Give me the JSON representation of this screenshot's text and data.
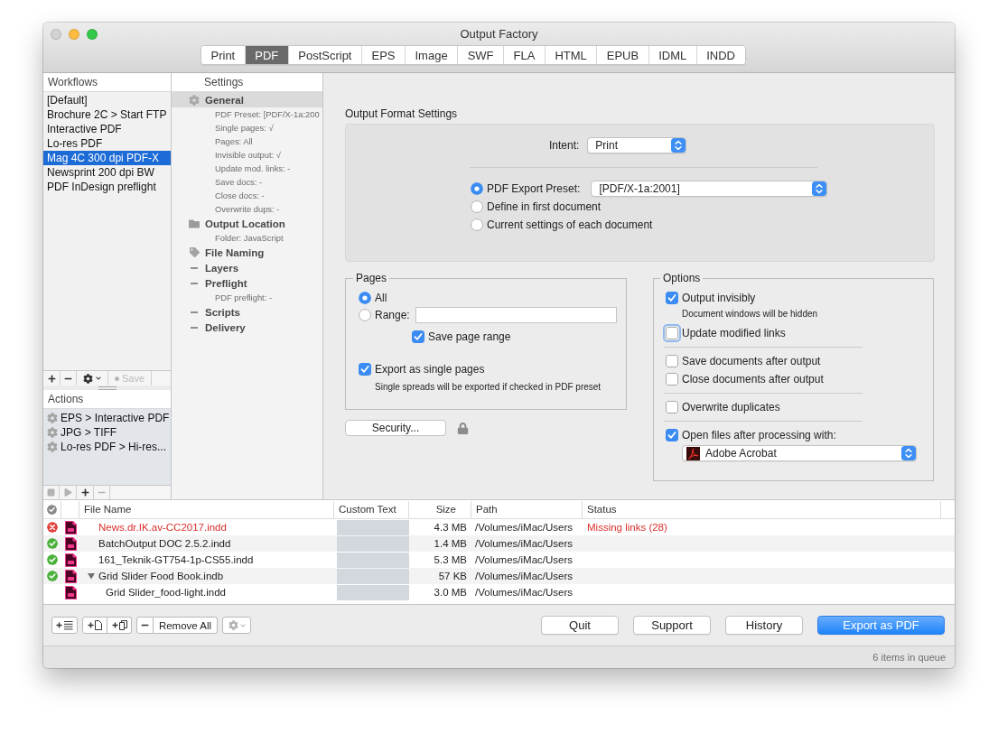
{
  "window": {
    "title": "Output Factory"
  },
  "format_tabs": [
    {
      "label": "Print",
      "selected": false
    },
    {
      "label": "PDF",
      "selected": true
    },
    {
      "label": "PostScript",
      "selected": false
    },
    {
      "label": "EPS",
      "selected": false
    },
    {
      "label": "Image",
      "selected": false
    },
    {
      "label": "SWF",
      "selected": false
    },
    {
      "label": "FLA",
      "selected": false
    },
    {
      "label": "HTML",
      "selected": false
    },
    {
      "label": "EPUB",
      "selected": false
    },
    {
      "label": "IDML",
      "selected": false
    },
    {
      "label": "INDD",
      "selected": false
    }
  ],
  "workflows": {
    "header": "Workflows",
    "items": [
      {
        "label": "[Default]",
        "selected": false
      },
      {
        "label": "Brochure 2C > Start FTP",
        "selected": false
      },
      {
        "label": "Interactive PDF",
        "selected": false
      },
      {
        "label": "Lo-res PDF",
        "selected": false
      },
      {
        "label": "Mag 4C 300 dpi PDF-X",
        "selected": true
      },
      {
        "label": "Newsprint 200 dpi BW",
        "selected": false
      },
      {
        "label": "PDF InDesign preflight",
        "selected": false
      }
    ],
    "tools": [
      {
        "kind": "add",
        "disabled": false
      },
      {
        "kind": "remove",
        "disabled": false
      },
      {
        "kind": "gear_menu",
        "disabled": false
      },
      {
        "kind": "save",
        "label": "Save",
        "disabled": true
      }
    ]
  },
  "actions": {
    "header": "Actions",
    "items": [
      {
        "label": "EPS > Interactive PDF"
      },
      {
        "label": "JPG > TIFF"
      },
      {
        "label": "Lo-res PDF > Hi-res..."
      }
    ],
    "tools": [
      {
        "kind": "stop",
        "disabled": true
      },
      {
        "kind": "play",
        "disabled": true
      },
      {
        "kind": "add",
        "disabled": false
      },
      {
        "kind": "remove",
        "disabled": true
      }
    ]
  },
  "settings": {
    "header": "Settings",
    "sections": [
      {
        "title": "General",
        "kind": "gear",
        "selected": true,
        "details": [
          "PDF Preset: [PDF/X-1a:200",
          "Single pages: √",
          "Pages: All",
          "Invisible output: √",
          "Update mod. links: -",
          "Save docs: -",
          "Close docs: -",
          "Overwrite dups: -"
        ]
      },
      {
        "title": "Output Location",
        "kind": "folder",
        "selected": false,
        "details": [
          "Folder: JavaScript"
        ]
      },
      {
        "title": "File Naming",
        "kind": "tag",
        "selected": false
      },
      {
        "title": "Layers",
        "kind": "dash",
        "selected": false
      },
      {
        "title": "Preflight",
        "kind": "dash",
        "selected": false,
        "details": [
          "PDF preflight: -"
        ]
      },
      {
        "title": "Scripts",
        "kind": "dash",
        "selected": false
      },
      {
        "title": "Delivery",
        "kind": "dash",
        "selected": false
      }
    ]
  },
  "output_format": {
    "title": "Output Format Settings",
    "intent": {
      "label": "Intent:",
      "value": "Print"
    },
    "preset_options": [
      {
        "label": "PDF Export Preset:",
        "selected": true,
        "value": "[PDF/X-1a:2001]"
      },
      {
        "label": "Define in first document",
        "selected": false
      },
      {
        "label": "Current settings of each document",
        "selected": false
      }
    ]
  },
  "pages": {
    "title": "Pages",
    "options": [
      {
        "label": "All",
        "selected": true
      },
      {
        "label": "Range:",
        "selected": false,
        "kind": "field"
      }
    ],
    "save_page_range": {
      "label": "Save page range",
      "checked": true
    },
    "single_pages": {
      "label": "Export as single pages",
      "checked": true,
      "note": "Single spreads will be exported if checked in PDF preset"
    }
  },
  "security_button": {
    "label": "Security..."
  },
  "options": {
    "title": "Options",
    "groups": [
      {
        "items": [
          {
            "label": "Output invisibly",
            "checked": true,
            "focused": false,
            "note": "Document windows will be hidden"
          },
          {
            "label": "Update modified links",
            "checked": false,
            "focused": true
          }
        ]
      },
      {
        "items": [
          {
            "label": "Save documents after output",
            "checked": false,
            "focused": false
          },
          {
            "label": "Close documents after output",
            "checked": false,
            "focused": false
          }
        ]
      },
      {
        "items": [
          {
            "label": "Overwrite duplicates",
            "checked": false,
            "focused": false
          }
        ]
      },
      {
        "items": [
          {
            "label": "Open files after processing with:",
            "checked": true,
            "focused": false,
            "app": "Adobe Acrobat"
          }
        ]
      }
    ]
  },
  "files": {
    "columns": [
      "File Name",
      "Custom Text",
      "Size",
      "Path",
      "Status"
    ],
    "rows": [
      {
        "kind": "error",
        "name": "News.dr.IK.av-CC2017.indd",
        "size": "4.3 MB",
        "path": "/Volumes/iMac/Users",
        "status": "Missing links (28)"
      },
      {
        "kind": "done",
        "name": "BatchOutput DOC 2.5.2.indd",
        "size": "1.4 MB",
        "path": "/Volumes/iMac/Users"
      },
      {
        "kind": "done",
        "name": "161_Teknik-GT754-1p-CS55.indd",
        "size": "5.3 MB",
        "path": "/Volumes/iMac/Users"
      },
      {
        "kind": "done",
        "name": "Grid Slider Food Book.indb",
        "size": "57 KB",
        "path": "/Volumes/iMac/Users",
        "expanded": true,
        "children": [
          {
            "name": "Grid Slider_food-light.indd",
            "size": "3.0 MB",
            "path": "/Volumes/iMac/Users"
          }
        ]
      }
    ]
  },
  "file_tools": [
    {
      "kind": "add_list",
      "disabled": false
    },
    {
      "kind": "add_file",
      "disabled": false
    },
    {
      "kind": "add_files",
      "disabled": false
    },
    {
      "kind": "remove",
      "disabled": false
    },
    {
      "kind": "remove_all",
      "label": "Remove All",
      "disabled": false
    },
    {
      "kind": "gear_menu",
      "disabled": true
    }
  ],
  "buttons": [
    {
      "label": "Quit",
      "kind": "normal"
    },
    {
      "label": "Support",
      "kind": "normal"
    },
    {
      "label": "History",
      "kind": "normal"
    },
    {
      "label": "Export as PDF",
      "kind": "primary"
    }
  ],
  "status_bar": {
    "text": "6 items in queue"
  }
}
